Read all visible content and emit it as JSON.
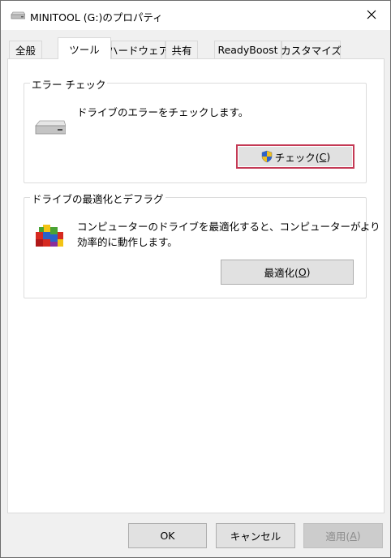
{
  "window": {
    "title": "MINITOOL (G:)のプロパティ",
    "close_icon": "close-icon",
    "title_icon": "drive-icon"
  },
  "tabs": [
    {
      "label": "全般",
      "active": false
    },
    {
      "label": "ツール",
      "active": true
    },
    {
      "label": "ハードウェア",
      "active": false
    },
    {
      "label": "共有",
      "active": false
    },
    {
      "label": "ReadyBoost",
      "active": false
    },
    {
      "label": "カスタマイズ",
      "active": false
    }
  ],
  "error_check": {
    "legend": "エラー チェック",
    "description": "ドライブのエラーをチェックします。",
    "button_label": "チェック(",
    "button_accel": "C",
    "button_close": ")",
    "icon": "drive-icon",
    "button_icon": "uac-shield-icon"
  },
  "optimize": {
    "legend": "ドライブの最適化とデフラグ",
    "description_line1": "コンピューターのドライブを最適化すると、コンピューターがより",
    "description_line2": "効率的に動作します。",
    "button_label": "最適化(",
    "button_accel": "O",
    "button_close": ")",
    "icon": "defrag-icon"
  },
  "footer": {
    "ok_label": "OK",
    "cancel_label": "キャンセル",
    "apply_label": "適用(",
    "apply_accel": "A",
    "apply_close": ")"
  },
  "colors": {
    "focus_border": "#c43a55",
    "window_bg": "#f0f0f0",
    "panel_bg": "#ffffff"
  }
}
